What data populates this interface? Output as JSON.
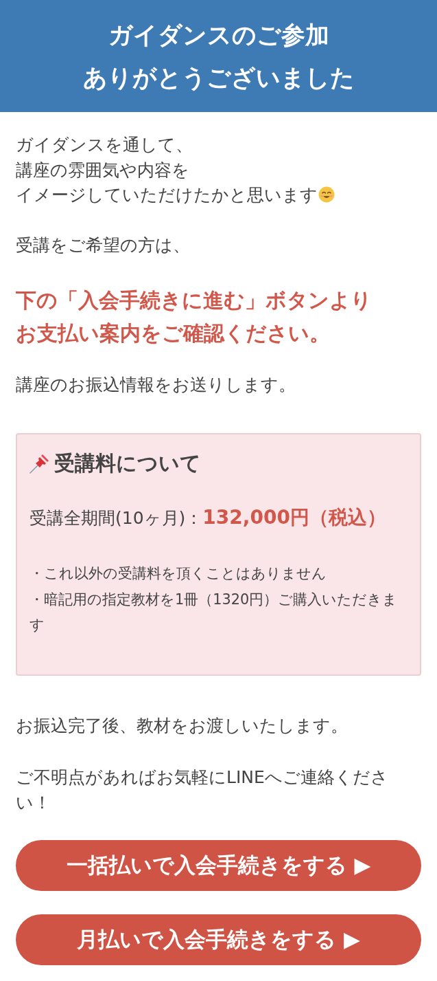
{
  "header": {
    "title_lines": [
      "ガイダンスのご参加",
      "ありがとうございました"
    ]
  },
  "intro": {
    "lines": [
      "ガイダンスを通して、",
      "講座の雰囲気や内容を",
      "イメージしていただけたかと思います"
    ]
  },
  "request": "受講をご希望の方は、",
  "notice": {
    "lines": [
      "下の「入会手続きに進む」ボタンより",
      "お支払い案内をご確認ください。"
    ]
  },
  "transfer_info": "講座のお振込情報をお送りします。",
  "fee_card": {
    "title": "受講料について",
    "period_label": "受講全期間(10ヶ月)：",
    "price": "132,000円（税込）",
    "notes": [
      "・これ以外の受講料を頂くことはありません",
      "・暗記用の指定教材を1冊（1320円）ご購入いただきます"
    ]
  },
  "after_payment": "お振込完了後、教材をお渡しいたします。",
  "contact": "ご不明点があればお気軽にLINEへご連絡ください！",
  "buttons": [
    {
      "label": "一括払いで入会手続きをする ▶"
    },
    {
      "label": "月払いで入会手続きをする ▶"
    }
  ]
}
